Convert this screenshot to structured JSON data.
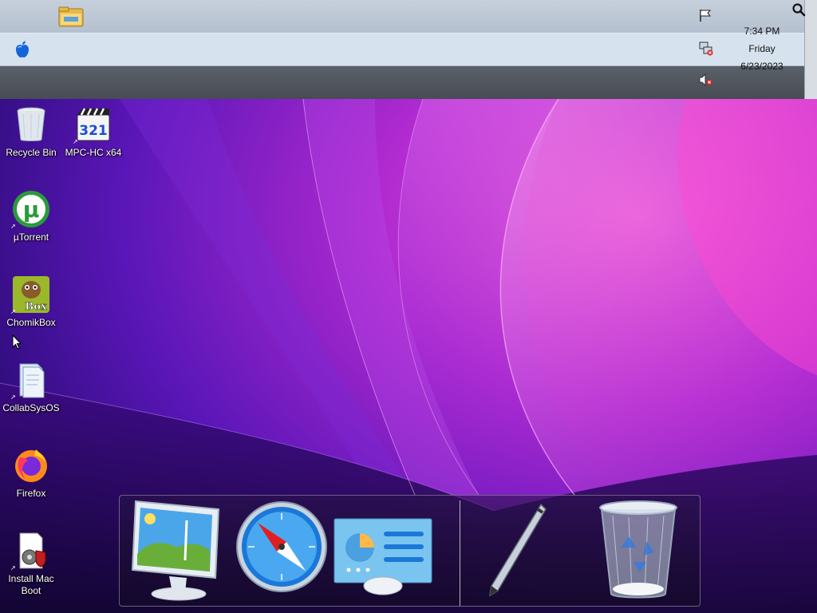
{
  "taskbar": {
    "icons": [
      "folder-icon",
      "apple-icon",
      "flag-icon",
      "network-icon",
      "volume-muted-icon",
      "search-icon"
    ],
    "clock": {
      "time": "7:34 PM",
      "day": "Friday",
      "date": "6/23/2023"
    }
  },
  "desktop": {
    "icons": [
      {
        "label": "Recycle Bin",
        "icon": "recycle-bin-icon"
      },
      {
        "label": "MPC-HC x64",
        "icon": "mpc-hc-icon"
      },
      {
        "label": "µTorrent",
        "icon": "utorrent-icon"
      },
      {
        "label": "ChomikBox",
        "icon": "chomikbox-icon"
      },
      {
        "label": "CollabSysOS",
        "icon": "folder-document-icon"
      },
      {
        "label": "Firefox",
        "icon": "firefox-icon"
      },
      {
        "label": "Install Mac\nBoot",
        "icon": "installer-icon"
      }
    ],
    "chomikbox_badge": "Box",
    "mpc_badge": "321"
  },
  "dock": {
    "items": [
      "photos-monitor-icon",
      "safari-compass-icon",
      "control-panel-icon",
      "pen-icon",
      "trash-icon"
    ]
  },
  "colors": {
    "wallpaper_pink": "#e040c8",
    "wallpaper_purple": "#5a16b8",
    "bar_light": "#d6e3ef",
    "bar_dark": "#4d525a"
  }
}
